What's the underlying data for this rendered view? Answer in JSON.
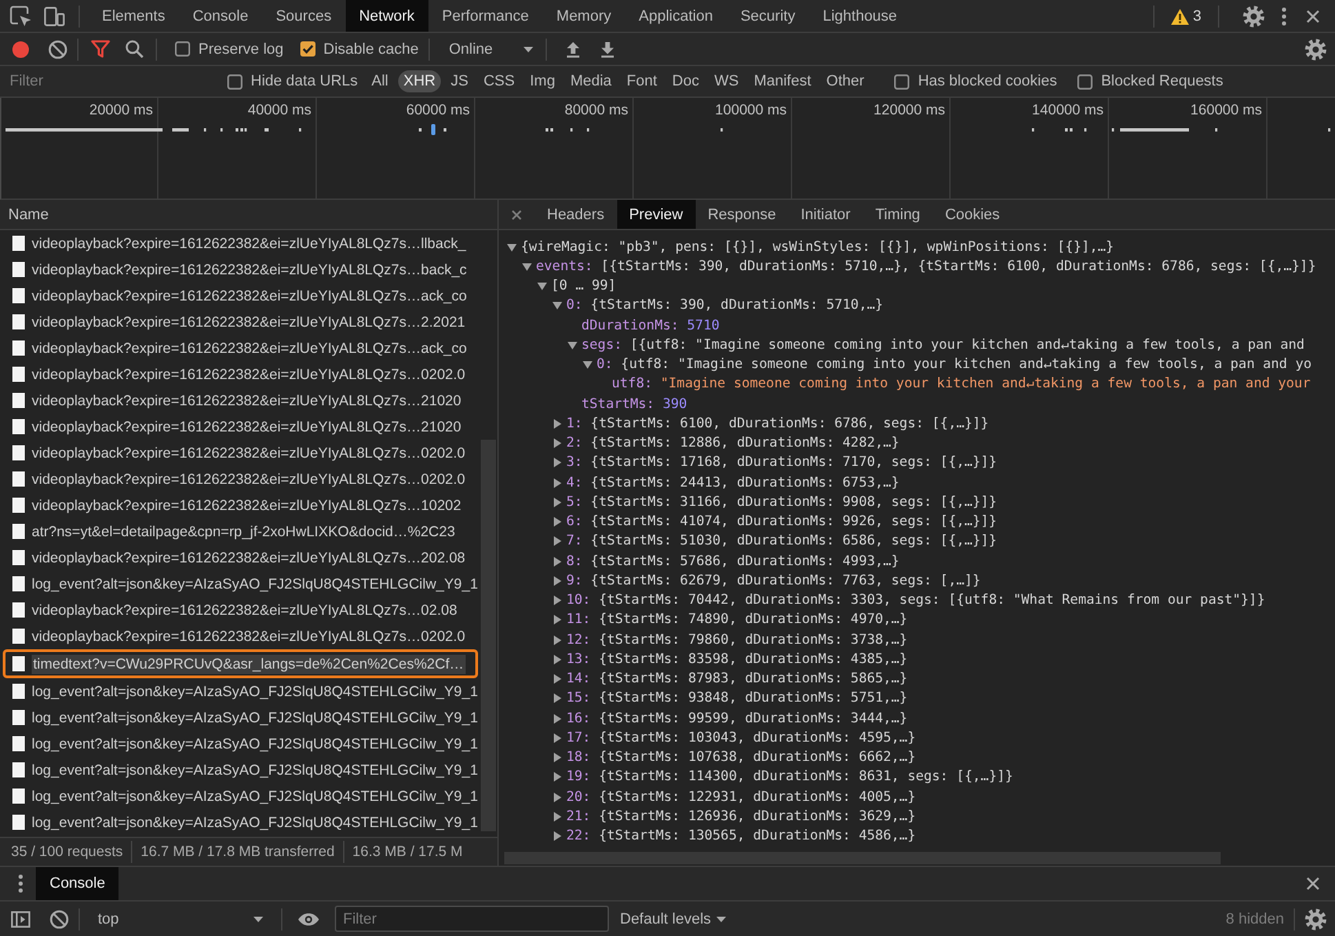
{
  "main_tabs": [
    {
      "label": "Elements",
      "selected": false
    },
    {
      "label": "Console",
      "selected": false
    },
    {
      "label": "Sources",
      "selected": false
    },
    {
      "label": "Network",
      "selected": true
    },
    {
      "label": "Performance",
      "selected": false
    },
    {
      "label": "Memory",
      "selected": false
    },
    {
      "label": "Application",
      "selected": false
    },
    {
      "label": "Security",
      "selected": false
    },
    {
      "label": "Lighthouse",
      "selected": false
    }
  ],
  "warnings": {
    "count": "3"
  },
  "network_toolbar": {
    "recording": true,
    "filter_enabled": true,
    "checkboxes": [
      {
        "label": "Preserve log",
        "checked": false
      },
      {
        "label": "Disable cache",
        "checked": true
      }
    ],
    "throttling": "Online"
  },
  "filter_bar": {
    "placeholder": "Filter",
    "hide_data_urls": {
      "label": "Hide data URLs",
      "checked": false
    },
    "types": [
      {
        "label": "All",
        "selected": false
      },
      {
        "label": "XHR",
        "selected": true
      },
      {
        "label": "JS",
        "selected": false
      },
      {
        "label": "CSS",
        "selected": false
      },
      {
        "label": "Img",
        "selected": false
      },
      {
        "label": "Media",
        "selected": false
      },
      {
        "label": "Font",
        "selected": false
      },
      {
        "label": "Doc",
        "selected": false
      },
      {
        "label": "WS",
        "selected": false
      },
      {
        "label": "Manifest",
        "selected": false
      },
      {
        "label": "Other",
        "selected": false
      }
    ],
    "extra_checkboxes": [
      {
        "label": "Has blocked cookies",
        "checked": false
      },
      {
        "label": "Blocked Requests",
        "checked": false
      }
    ]
  },
  "overview": {
    "ticks": [
      "20000 ms",
      "40000 ms",
      "60000 ms",
      "80000 ms",
      "100000 ms",
      "120000 ms",
      "140000 ms",
      "160000 ms"
    ]
  },
  "requests": {
    "column": "Name",
    "rows": [
      {
        "name": "videoplayback?expire=1612622382&ei=zlUeYIyAL8LQz7s…llback_",
        "selected": false
      },
      {
        "name": "videoplayback?expire=1612622382&ei=zlUeYIyAL8LQz7s…back_c",
        "selected": false
      },
      {
        "name": "videoplayback?expire=1612622382&ei=zlUeYIyAL8LQz7s…ack_co",
        "selected": false
      },
      {
        "name": "videoplayback?expire=1612622382&ei=zlUeYIyAL8LQz7s…2.2021",
        "selected": false
      },
      {
        "name": "videoplayback?expire=1612622382&ei=zlUeYIyAL8LQz7s…ack_co",
        "selected": false
      },
      {
        "name": "videoplayback?expire=1612622382&ei=zlUeYIyAL8LQz7s…0202.0",
        "selected": false
      },
      {
        "name": "videoplayback?expire=1612622382&ei=zlUeYIyAL8LQz7s…21020",
        "selected": false
      },
      {
        "name": "videoplayback?expire=1612622382&ei=zlUeYIyAL8LQz7s…21020",
        "selected": false
      },
      {
        "name": "videoplayback?expire=1612622382&ei=zlUeYIyAL8LQz7s…0202.0",
        "selected": false
      },
      {
        "name": "videoplayback?expire=1612622382&ei=zlUeYIyAL8LQz7s…0202.0",
        "selected": false
      },
      {
        "name": "videoplayback?expire=1612622382&ei=zlUeYIyAL8LQz7s…10202",
        "selected": false
      },
      {
        "name": "atr?ns=yt&el=detailpage&cpn=rp_jf-2xoHwLIXKO&docid…%2C23",
        "selected": false
      },
      {
        "name": "videoplayback?expire=1612622382&ei=zlUeYIyAL8LQz7s…202.08",
        "selected": false
      },
      {
        "name": "log_event?alt=json&key=AIzaSyAO_FJ2SlqU8Q4STEHLGCilw_Y9_1",
        "selected": false
      },
      {
        "name": "videoplayback?expire=1612622382&ei=zlUeYIyAL8LQz7s…02.08",
        "selected": false
      },
      {
        "name": "videoplayback?expire=1612622382&ei=zlUeYIyAL8LQz7s…0202.0",
        "selected": false
      },
      {
        "name": "timedtext?v=CWu29PRCUvQ&asr_langs=de%2Cen%2Ces%2Cf…",
        "selected": true
      },
      {
        "name": "log_event?alt=json&key=AIzaSyAO_FJ2SlqU8Q4STEHLGCilw_Y9_1",
        "selected": false
      },
      {
        "name": "log_event?alt=json&key=AIzaSyAO_FJ2SlqU8Q4STEHLGCilw_Y9_1",
        "selected": false
      },
      {
        "name": "log_event?alt=json&key=AIzaSyAO_FJ2SlqU8Q4STEHLGCilw_Y9_1",
        "selected": false
      },
      {
        "name": "log_event?alt=json&key=AIzaSyAO_FJ2SlqU8Q4STEHLGCilw_Y9_1",
        "selected": false
      },
      {
        "name": "log_event?alt=json&key=AIzaSyAO_FJ2SlqU8Q4STEHLGCilw_Y9_1",
        "selected": false
      },
      {
        "name": "log_event?alt=json&key=AIzaSyAO_FJ2SlqU8Q4STEHLGCilw_Y9_1",
        "selected": false
      }
    ],
    "summary": [
      "35 / 100 requests",
      "16.7 MB / 17.8 MB transferred",
      "16.3 MB / 17.5 M"
    ]
  },
  "detail_tabs": [
    {
      "label": "Headers",
      "selected": false
    },
    {
      "label": "Preview",
      "selected": true
    },
    {
      "label": "Response",
      "selected": false
    },
    {
      "label": "Initiator",
      "selected": false
    },
    {
      "label": "Timing",
      "selected": false
    },
    {
      "label": "Cookies",
      "selected": false
    }
  ],
  "preview": {
    "tree": [
      {
        "kind": "object",
        "value": "{wireMagic: \"pb3\", pens: [{}], wsWinStyles: [{}], wpWinPositions: [{}],…}",
        "expanded": true,
        "children": [
          {
            "kind": "object",
            "key": "events:",
            "value": "[{tStartMs: 390, dDurationMs: 5710,…}, {tStartMs: 6100, dDurationMs: 6786, segs: [{,…}]}",
            "expanded": true,
            "children": [
              {
                "kind": "object",
                "value": "[0 … 99]",
                "expanded": true,
                "children": [
                  {
                    "kind": "object",
                    "key": "0:",
                    "value": "{tStartMs: 390, dDurationMs: 5710,…}",
                    "expanded": true,
                    "children": [
                      {
                        "kind": "number",
                        "key": "dDurationMs:",
                        "value": "5710"
                      },
                      {
                        "kind": "object",
                        "key": "segs:",
                        "value": "[{utf8: \"Imagine someone coming into your kitchen and↵taking a few tools, a pan and",
                        "expanded": true,
                        "children": [
                          {
                            "kind": "object",
                            "key": "0:",
                            "value": "{utf8: \"Imagine someone coming into your kitchen and↵taking a few tools, a pan and yo",
                            "expanded": true,
                            "children": [
                              {
                                "kind": "string",
                                "key": "utf8:",
                                "value": "\"Imagine someone coming into your kitchen and↵taking a few tools, a pan and your"
                              }
                            ]
                          }
                        ]
                      },
                      {
                        "kind": "number",
                        "key": "tStartMs:",
                        "value": "390"
                      }
                    ]
                  },
                  {
                    "kind": "object",
                    "key": "1:",
                    "value": "{tStartMs: 6100, dDurationMs: 6786, segs: [{,…}]}",
                    "expanded": false
                  },
                  {
                    "kind": "object",
                    "key": "2:",
                    "value": "{tStartMs: 12886, dDurationMs: 4282,…}",
                    "expanded": false
                  },
                  {
                    "kind": "object",
                    "key": "3:",
                    "value": "{tStartMs: 17168, dDurationMs: 7170, segs: [{,…}]}",
                    "expanded": false
                  },
                  {
                    "kind": "object",
                    "key": "4:",
                    "value": "{tStartMs: 24413, dDurationMs: 6753,…}",
                    "expanded": false
                  },
                  {
                    "kind": "object",
                    "key": "5:",
                    "value": "{tStartMs: 31166, dDurationMs: 9908, segs: [{,…}]}",
                    "expanded": false
                  },
                  {
                    "kind": "object",
                    "key": "6:",
                    "value": "{tStartMs: 41074, dDurationMs: 9926, segs: [{,…}]}",
                    "expanded": false
                  },
                  {
                    "kind": "object",
                    "key": "7:",
                    "value": "{tStartMs: 51030, dDurationMs: 6586, segs: [{,…}]}",
                    "expanded": false
                  },
                  {
                    "kind": "object",
                    "key": "8:",
                    "value": "{tStartMs: 57686, dDurationMs: 4993,…}",
                    "expanded": false
                  },
                  {
                    "kind": "object",
                    "key": "9:",
                    "value": "{tStartMs: 62679, dDurationMs: 7763, segs: [,…]}",
                    "expanded": false
                  },
                  {
                    "kind": "object",
                    "key": "10:",
                    "value": "{tStartMs: 70442, dDurationMs: 3303, segs: [{utf8: \"What Remains from our past\"}]}",
                    "expanded": false
                  },
                  {
                    "kind": "object",
                    "key": "11:",
                    "value": "{tStartMs: 74890, dDurationMs: 4970,…}",
                    "expanded": false
                  },
                  {
                    "kind": "object",
                    "key": "12:",
                    "value": "{tStartMs: 79860, dDurationMs: 3738,…}",
                    "expanded": false
                  },
                  {
                    "kind": "object",
                    "key": "13:",
                    "value": "{tStartMs: 83598, dDurationMs: 4385,…}",
                    "expanded": false
                  },
                  {
                    "kind": "object",
                    "key": "14:",
                    "value": "{tStartMs: 87983, dDurationMs: 5865,…}",
                    "expanded": false
                  },
                  {
                    "kind": "object",
                    "key": "15:",
                    "value": "{tStartMs: 93848, dDurationMs: 5751,…}",
                    "expanded": false
                  },
                  {
                    "kind": "object",
                    "key": "16:",
                    "value": "{tStartMs: 99599, dDurationMs: 3444,…}",
                    "expanded": false
                  },
                  {
                    "kind": "object",
                    "key": "17:",
                    "value": "{tStartMs: 103043, dDurationMs: 4595,…}",
                    "expanded": false
                  },
                  {
                    "kind": "object",
                    "key": "18:",
                    "value": "{tStartMs: 107638, dDurationMs: 6662,…}",
                    "expanded": false
                  },
                  {
                    "kind": "object",
                    "key": "19:",
                    "value": "{tStartMs: 114300, dDurationMs: 8631, segs: [{,…}]}",
                    "expanded": false
                  },
                  {
                    "kind": "object",
                    "key": "20:",
                    "value": "{tStartMs: 122931, dDurationMs: 4005,…}",
                    "expanded": false
                  },
                  {
                    "kind": "object",
                    "key": "21:",
                    "value": "{tStartMs: 126936, dDurationMs: 3629,…}",
                    "expanded": false
                  },
                  {
                    "kind": "object",
                    "key": "22:",
                    "value": "{tStartMs: 130565, dDurationMs: 4586,…}",
                    "expanded": false
                  }
                ]
              }
            ]
          }
        ]
      }
    ]
  },
  "drawer": {
    "tabs": [
      {
        "label": "Console",
        "selected": true
      }
    ],
    "context": "top",
    "filter_placeholder": "Filter",
    "levels": "Default levels",
    "hidden": "8 hidden"
  }
}
